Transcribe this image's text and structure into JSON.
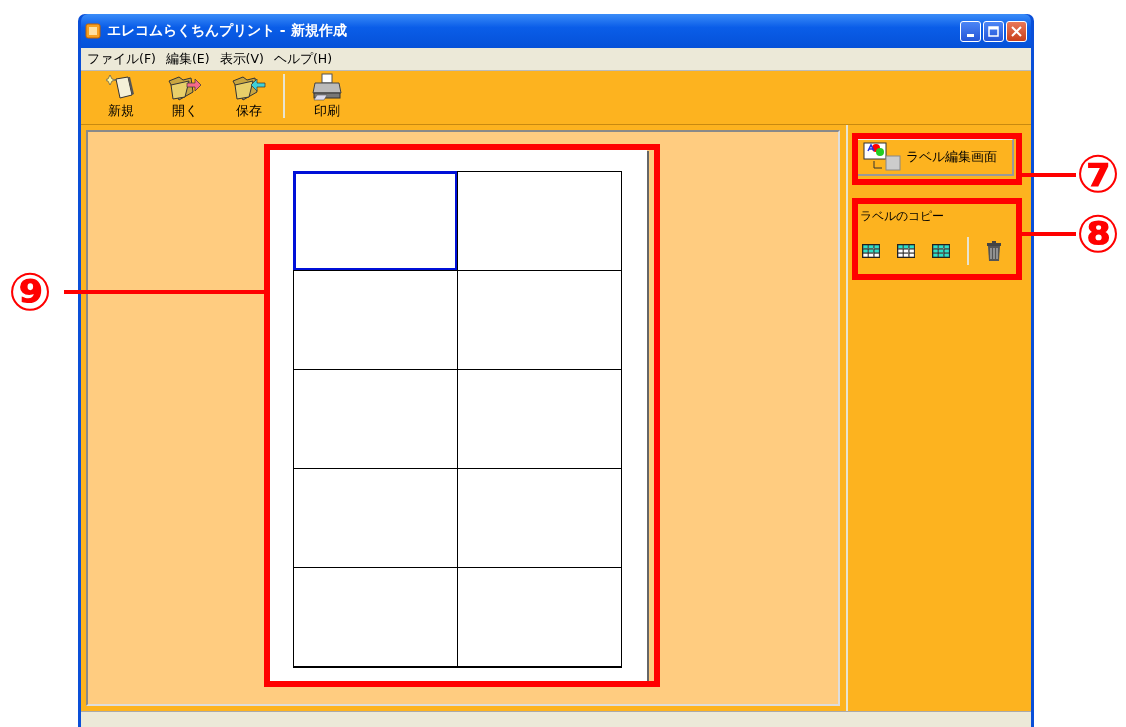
{
  "window": {
    "title": "エレコムらくちんプリント - 新規作成"
  },
  "menu": [
    {
      "label": "ファイル(F)"
    },
    {
      "label": "編集(E)"
    },
    {
      "label": "表示(V)"
    },
    {
      "label": "ヘルプ(H)"
    }
  ],
  "toolbar": [
    {
      "label": "新規",
      "kind": "new"
    },
    {
      "label": "開く",
      "kind": "open"
    },
    {
      "label": "保存",
      "kind": "save"
    },
    {
      "label": "印刷",
      "kind": "print"
    }
  ],
  "sheet": {
    "labels": [
      {
        "selected": true
      },
      {
        "selected": false
      },
      {
        "selected": false
      },
      {
        "selected": false
      },
      {
        "selected": false
      },
      {
        "selected": false
      },
      {
        "selected": false
      },
      {
        "selected": false
      },
      {
        "selected": false
      },
      {
        "selected": false
      }
    ]
  },
  "side_panel": {
    "edit_button": "ラベル編集画面",
    "copy_group": {
      "title": "ラベルのコピー",
      "buttons": [
        {
          "kind": "grid"
        },
        {
          "kind": "grid"
        },
        {
          "kind": "grid"
        },
        {
          "kind": "delete"
        }
      ]
    }
  },
  "callouts": [
    {
      "number": "⑦"
    },
    {
      "number": "⑧"
    },
    {
      "number": "⑨"
    }
  ]
}
